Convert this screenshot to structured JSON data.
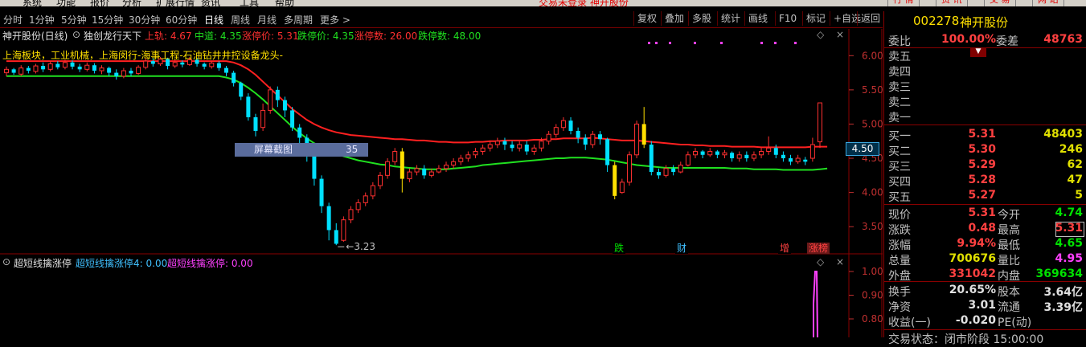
{
  "menu": {
    "items": [
      "系统",
      "功能",
      "报价",
      "分析",
      "扩展行情",
      "资讯",
      "工具",
      "帮助"
    ],
    "status": "交易未登录  神开股份",
    "right_buttons": [
      "行 情",
      "资 讯",
      "交 易",
      "网 站"
    ]
  },
  "toolbar": {
    "periods": [
      "分时",
      "1分钟",
      "5分钟",
      "15分钟",
      "30分钟",
      "60分钟",
      "日线",
      "周线",
      "月线",
      "多周期",
      "更多 >"
    ],
    "active_period": "日线",
    "right_buttons": [
      "复权",
      "叠加",
      "多股",
      "统计",
      "画线",
      "F10",
      "标记",
      "+自选",
      "返回"
    ]
  },
  "chart": {
    "title": "神开股份(日线)",
    "indicator_name": "独创龙行天下",
    "upper_label": "上轨: 4.67",
    "middle_label": "中道: 4.35",
    "limit_up_label": "涨停价: 5.31",
    "limit_down_label": "跌停价: 4.35",
    "limit_up_count": "涨停数: 26.00",
    "limit_down_count": "跌停数: 48.00",
    "concepts": "上海板块，工业机械，上海闵行-海事工程-石油钻井井控设备龙头-",
    "screenshot_tip": "屏幕截图",
    "screenshot_num": "35",
    "low_label": "3.23",
    "current_price_box": "4.50",
    "price_ticks": [
      "6.00",
      "5.50",
      "5.00",
      "4.50",
      "4.00",
      "3.50"
    ],
    "markers": [
      "跌",
      "财",
      "增",
      "涨榜"
    ],
    "sub_indicator": "超短线擒涨停",
    "sub_value1": "超短线擒涨停4: 0.00",
    "sub_value2": "超短线擒涨停: 0.00",
    "sub_ticks": [
      "1.00",
      "0.90",
      "0.80"
    ],
    "colors": {
      "up": "#ff3030",
      "down": "#00e0ff",
      "upper": "#ff2020",
      "middle": "#20e020",
      "yellow": "#ffe000",
      "magenta": "#ff40ff"
    }
  },
  "stock": {
    "code": "002278",
    "name": "神开股份"
  },
  "panel": {
    "weibi_label": "委比",
    "weibi_value": "100.00%",
    "weicha_label": "委差",
    "weicha_value": "48763",
    "sell": [
      {
        "label": "卖五",
        "price": "",
        "vol": ""
      },
      {
        "label": "卖四",
        "price": "",
        "vol": ""
      },
      {
        "label": "卖三",
        "price": "",
        "vol": ""
      },
      {
        "label": "卖二",
        "price": "",
        "vol": ""
      },
      {
        "label": "卖一",
        "price": "",
        "vol": ""
      }
    ],
    "buy": [
      {
        "label": "买一",
        "price": "5.31",
        "vol": "48403"
      },
      {
        "label": "买二",
        "price": "5.30",
        "vol": "246"
      },
      {
        "label": "买三",
        "price": "5.29",
        "vol": "62"
      },
      {
        "label": "买四",
        "price": "5.28",
        "vol": "47"
      },
      {
        "label": "买五",
        "price": "5.27",
        "vol": "5"
      }
    ],
    "quote": [
      {
        "l1": "现价",
        "v1": "5.31",
        "l2": "今开",
        "v2": "4.74"
      },
      {
        "l1": "涨跌",
        "v1": "0.48",
        "l2": "最高",
        "v2": "5.31"
      },
      {
        "l1": "涨幅",
        "v1": "9.94%",
        "l2": "最低",
        "v2": "4.65"
      },
      {
        "l1": "总量",
        "v1": "700676",
        "l2": "量比",
        "v2": "4.95"
      },
      {
        "l1": "外盘",
        "v1": "331042",
        "l2": "内盘",
        "v2": "369634"
      }
    ],
    "fin": [
      {
        "l1": "换手",
        "v1": "20.65%",
        "l2": "股本",
        "v2": "3.64亿"
      },
      {
        "l1": "净资",
        "v1": "3.01",
        "l2": "流通",
        "v2": "3.39亿"
      },
      {
        "l1": "收益(一)",
        "v1": "-0.020",
        "l2": "PE(动)",
        "v2": ""
      }
    ],
    "bottom_cut": "交易状态：闭市阶段   15:00:00"
  },
  "chart_data": {
    "type": "candlestick",
    "period": "daily",
    "y_range": [
      3.15,
      6.25
    ],
    "candles": [
      [
        5.75,
        5.8,
        5.7,
        5.84
      ],
      [
        5.8,
        5.75,
        5.72,
        5.82
      ],
      [
        5.73,
        5.82,
        5.7,
        5.86
      ],
      [
        5.82,
        5.78,
        5.74,
        5.85
      ],
      [
        5.77,
        5.85,
        5.74,
        5.88
      ],
      [
        5.85,
        5.8,
        5.76,
        5.9
      ],
      [
        5.8,
        5.88,
        5.77,
        5.92
      ],
      [
        5.88,
        5.83,
        5.8,
        5.92
      ],
      [
        5.83,
        5.9,
        5.8,
        5.94
      ],
      [
        5.9,
        5.84,
        5.8,
        5.93
      ],
      [
        5.84,
        5.8,
        5.76,
        5.88
      ],
      [
        5.8,
        5.86,
        5.77,
        5.9
      ],
      [
        5.86,
        5.78,
        5.74,
        5.89
      ],
      [
        5.78,
        5.82,
        5.73,
        5.86
      ],
      [
        5.82,
        5.75,
        5.7,
        5.84
      ],
      [
        5.75,
        5.7,
        5.65,
        5.8
      ],
      [
        5.7,
        5.78,
        5.67,
        5.82
      ],
      [
        5.78,
        5.74,
        5.7,
        5.82
      ],
      [
        5.74,
        5.83,
        5.72,
        5.86
      ],
      [
        5.83,
        5.92,
        5.8,
        5.96
      ],
      [
        5.92,
        5.88,
        5.84,
        5.96
      ],
      [
        5.88,
        5.95,
        5.85,
        5.98
      ],
      [
        5.95,
        5.85,
        5.8,
        5.97
      ],
      [
        5.85,
        5.9,
        5.82,
        5.94
      ],
      [
        5.9,
        5.87,
        5.83,
        5.93
      ],
      [
        5.87,
        5.94,
        5.85,
        5.98
      ],
      [
        5.94,
        5.88,
        5.84,
        5.97
      ],
      [
        5.88,
        5.84,
        5.8,
        5.9
      ],
      [
        5.84,
        5.89,
        5.81,
        5.92
      ],
      [
        5.89,
        5.82,
        5.78,
        5.92
      ],
      [
        5.82,
        5.75,
        5.7,
        5.85
      ],
      [
        5.75,
        5.6,
        5.55,
        5.78
      ],
      [
        5.6,
        5.4,
        5.35,
        5.62
      ],
      [
        5.4,
        5.1,
        5.05,
        5.45
      ],
      [
        5.1,
        4.9,
        4.82,
        5.15
      ],
      [
        4.95,
        5.2,
        4.9,
        5.3
      ],
      [
        5.2,
        5.5,
        5.15,
        5.55
      ],
      [
        5.5,
        5.35,
        5.25,
        5.55
      ],
      [
        5.35,
        5.2,
        5.1,
        5.4
      ],
      [
        5.2,
        4.95,
        4.9,
        5.25
      ],
      [
        4.95,
        4.8,
        4.7,
        5.0
      ],
      [
        4.8,
        4.55,
        4.45,
        4.85
      ],
      [
        4.55,
        4.2,
        4.1,
        4.6
      ],
      [
        4.2,
        3.8,
        3.7,
        4.25
      ],
      [
        3.8,
        3.45,
        3.3,
        3.85
      ],
      [
        3.45,
        3.25,
        3.23,
        3.55
      ],
      [
        3.3,
        3.6,
        3.28,
        3.65
      ],
      [
        3.6,
        3.75,
        3.55,
        3.8
      ],
      [
        3.75,
        3.85,
        3.7,
        3.9
      ],
      [
        3.85,
        3.95,
        3.8,
        4.0
      ],
      [
        3.95,
        4.1,
        3.9,
        4.15
      ],
      [
        4.1,
        4.25,
        4.05,
        4.3
      ],
      [
        4.25,
        4.45,
        4.2,
        4.5
      ],
      [
        4.45,
        4.6,
        4.4,
        4.65
      ],
      [
        4.6,
        4.2,
        4.0,
        4.65
      ],
      [
        4.2,
        4.3,
        4.15,
        4.35
      ],
      [
        4.3,
        4.35,
        4.25,
        4.4
      ],
      [
        4.35,
        4.25,
        4.2,
        4.4
      ],
      [
        4.25,
        4.3,
        4.22,
        4.35
      ],
      [
        4.3,
        4.35,
        4.28,
        4.4
      ],
      [
        4.35,
        4.4,
        4.3,
        4.45
      ],
      [
        4.4,
        4.45,
        4.35,
        4.5
      ],
      [
        4.45,
        4.5,
        4.4,
        4.55
      ],
      [
        4.5,
        4.55,
        4.45,
        4.6
      ],
      [
        4.55,
        4.6,
        4.5,
        4.65
      ],
      [
        4.6,
        4.65,
        4.55,
        4.7
      ],
      [
        4.65,
        4.7,
        4.6,
        4.75
      ],
      [
        4.7,
        4.75,
        4.65,
        4.8
      ],
      [
        4.75,
        4.7,
        4.62,
        4.8
      ],
      [
        4.7,
        4.65,
        4.6,
        4.75
      ],
      [
        4.65,
        4.7,
        4.6,
        4.75
      ],
      [
        4.7,
        4.6,
        4.55,
        4.75
      ],
      [
        4.6,
        4.65,
        4.55,
        4.7
      ],
      [
        4.65,
        4.75,
        4.6,
        4.8
      ],
      [
        4.75,
        4.85,
        4.7,
        4.9
      ],
      [
        4.85,
        4.95,
        4.8,
        5.0
      ],
      [
        4.95,
        5.05,
        4.9,
        5.1
      ],
      [
        5.05,
        4.9,
        4.85,
        5.1
      ],
      [
        4.9,
        4.8,
        4.72,
        4.95
      ],
      [
        4.8,
        4.7,
        4.62,
        4.85
      ],
      [
        4.7,
        4.85,
        4.65,
        4.9
      ],
      [
        4.85,
        4.78,
        4.7,
        4.9
      ],
      [
        4.78,
        4.4,
        4.3,
        4.8
      ],
      [
        4.4,
        3.95,
        3.9,
        4.45
      ],
      [
        4.0,
        4.15,
        3.98,
        4.2
      ],
      [
        4.15,
        4.55,
        4.1,
        4.6
      ],
      [
        4.55,
        5.0,
        4.5,
        5.05
      ],
      [
        5.0,
        4.7,
        4.65,
        5.25
      ],
      [
        4.7,
        4.3,
        4.25,
        4.75
      ],
      [
        4.3,
        4.25,
        4.2,
        4.35
      ],
      [
        4.25,
        4.35,
        4.22,
        4.4
      ],
      [
        4.35,
        4.3,
        4.25,
        4.4
      ],
      [
        4.3,
        4.4,
        4.28,
        4.45
      ],
      [
        4.4,
        4.55,
        4.38,
        4.6
      ],
      [
        4.55,
        4.6,
        4.5,
        4.65
      ],
      [
        4.6,
        4.55,
        4.5,
        4.62
      ],
      [
        4.55,
        4.6,
        4.52,
        4.65
      ],
      [
        4.6,
        4.55,
        4.5,
        4.62
      ],
      [
        4.55,
        4.58,
        4.5,
        4.62
      ],
      [
        4.58,
        4.5,
        4.45,
        4.6
      ],
      [
        4.5,
        4.55,
        4.45,
        4.6
      ],
      [
        4.55,
        4.5,
        4.45,
        4.6
      ],
      [
        4.5,
        4.55,
        4.46,
        4.6
      ],
      [
        4.55,
        4.6,
        4.5,
        4.65
      ],
      [
        4.6,
        4.65,
        4.55,
        4.82
      ],
      [
        4.65,
        4.55,
        4.5,
        4.7
      ],
      [
        4.55,
        4.5,
        4.45,
        4.6
      ],
      [
        4.5,
        4.45,
        4.4,
        4.55
      ],
      [
        4.45,
        4.5,
        4.42,
        4.55
      ],
      [
        4.48,
        4.45,
        4.4,
        4.52
      ],
      [
        4.5,
        4.7,
        4.45,
        4.8
      ],
      [
        4.74,
        5.31,
        4.65,
        5.31
      ]
    ],
    "upper_band": [
      5.92,
      5.92,
      5.92,
      5.92,
      5.92,
      5.92,
      5.92,
      5.92,
      5.92,
      5.92,
      5.92,
      5.92,
      5.92,
      5.92,
      5.92,
      5.92,
      5.92,
      5.92,
      5.92,
      5.92,
      5.92,
      5.92,
      5.92,
      5.92,
      5.92,
      5.92,
      5.92,
      5.92,
      5.92,
      5.92,
      5.92,
      5.9,
      5.86,
      5.8,
      5.72,
      5.62,
      5.52,
      5.42,
      5.32,
      5.22,
      5.14,
      5.06,
      5.0,
      4.95,
      4.91,
      4.88,
      4.86,
      4.84,
      4.83,
      4.82,
      4.81,
      4.8,
      4.79,
      4.78,
      4.78,
      4.77,
      4.76,
      4.76,
      4.75,
      4.74,
      4.74,
      4.73,
      4.73,
      4.73,
      4.74,
      4.74,
      4.75,
      4.75,
      4.76,
      4.76,
      4.76,
      4.76,
      4.77,
      4.77,
      4.78,
      4.78,
      4.79,
      4.79,
      4.79,
      4.79,
      4.8,
      4.79,
      4.78,
      4.77,
      4.76,
      4.76,
      4.76,
      4.75,
      4.74,
      4.73,
      4.72,
      4.71,
      4.7,
      4.7,
      4.69,
      4.69,
      4.68,
      4.68,
      4.68,
      4.67,
      4.67,
      4.67,
      4.67,
      4.66,
      4.66,
      4.66,
      4.66,
      4.66,
      4.66,
      4.66,
      4.67,
      4.67,
      4.67
    ],
    "middle_band": [
      5.7,
      5.7,
      5.7,
      5.7,
      5.7,
      5.7,
      5.7,
      5.7,
      5.7,
      5.7,
      5.7,
      5.7,
      5.7,
      5.7,
      5.7,
      5.7,
      5.7,
      5.7,
      5.7,
      5.7,
      5.7,
      5.7,
      5.7,
      5.7,
      5.7,
      5.7,
      5.7,
      5.7,
      5.7,
      5.7,
      5.68,
      5.65,
      5.6,
      5.53,
      5.45,
      5.36,
      5.26,
      5.16,
      5.06,
      4.96,
      4.87,
      4.79,
      4.72,
      4.66,
      4.61,
      4.57,
      4.53,
      4.5,
      4.47,
      4.45,
      4.43,
      4.41,
      4.4,
      4.38,
      4.37,
      4.36,
      4.35,
      4.34,
      4.34,
      4.34,
      4.34,
      4.35,
      4.36,
      4.37,
      4.38,
      4.4,
      4.41,
      4.42,
      4.43,
      4.44,
      4.45,
      4.46,
      4.47,
      4.48,
      4.49,
      4.5,
      4.5,
      4.51,
      4.51,
      4.51,
      4.5,
      4.49,
      4.48,
      4.46,
      4.44,
      4.42,
      4.4,
      4.39,
      4.38,
      4.37,
      4.36,
      4.36,
      4.36,
      4.36,
      4.36,
      4.36,
      4.36,
      4.36,
      4.36,
      4.35,
      4.35,
      4.35,
      4.34,
      4.34,
      4.34,
      4.34,
      4.33,
      4.33,
      4.33,
      4.33,
      4.33,
      4.34,
      4.35
    ]
  }
}
